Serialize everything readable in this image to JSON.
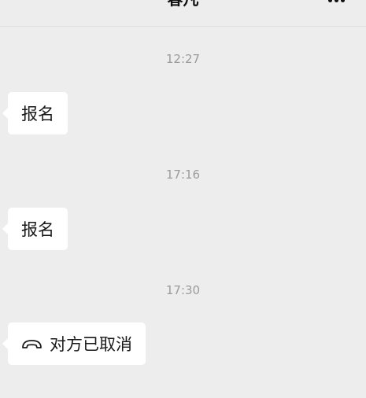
{
  "header": {
    "title": "春凡",
    "more_icon": "more-dots-icon"
  },
  "messages": [
    {
      "time": "12:27",
      "text": "报名"
    },
    {
      "time": "17:16",
      "text": "报名"
    },
    {
      "time": "17:30",
      "text": "对方已取消",
      "icon": "hang-up-phone-icon"
    }
  ],
  "colors": {
    "background": "#ededed",
    "bubble": "#ffffff",
    "timestamp": "#9b9b9b",
    "text": "#191919"
  }
}
